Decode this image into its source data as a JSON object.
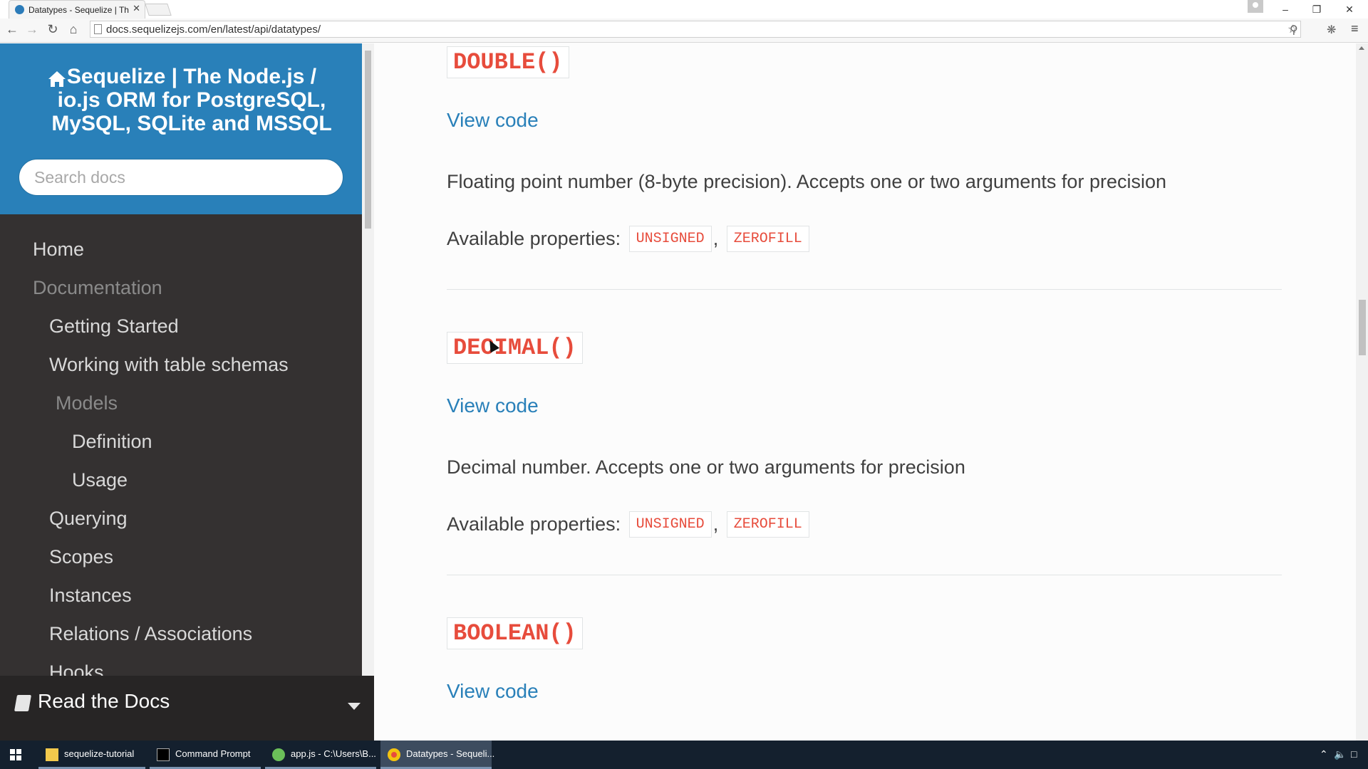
{
  "browser": {
    "tab_title": "Datatypes - Sequelize | Th",
    "tab_close": "✕",
    "url": "docs.sequelizejs.com/en/latest/api/datatypes/"
  },
  "sidebar": {
    "project_title": "Sequelize | The Node.js / io.js ORM for PostgreSQL, MySQL, SQLite and MSSQL",
    "search_placeholder": "Search docs",
    "nav": {
      "home": "Home",
      "documentation": "Documentation",
      "getting_started": "Getting Started",
      "working_with_schemas": "Working with table schemas",
      "models": "Models",
      "definition": "Definition",
      "usage": "Usage",
      "querying": "Querying",
      "scopes": "Scopes",
      "instances": "Instances",
      "relations": "Relations / Associations",
      "hooks": "Hooks"
    },
    "read_the_docs": "Read the Docs"
  },
  "content": {
    "sections": [
      {
        "title": "DOUBLE()",
        "view_code": "View code",
        "description": "Floating point number (8-byte precision). Accepts one or two arguments for precision",
        "props_label": "Available properties:",
        "props": [
          "UNSIGNED",
          "ZEROFILL"
        ]
      },
      {
        "title": "DECIMAL()",
        "view_code": "View code",
        "description": "Decimal number. Accepts one or two arguments for precision",
        "props_label": "Available properties:",
        "props": [
          "UNSIGNED",
          "ZEROFILL"
        ]
      },
      {
        "title": "BOOLEAN()",
        "view_code": "View code"
      }
    ],
    "comma": ","
  },
  "taskbar": {
    "items": [
      "sequelize-tutorial",
      "Command Prompt",
      "app.js - C:\\Users\\B...",
      "Datatypes - Sequeli..."
    ]
  },
  "colors": {
    "sidebar_header": "#2980b9",
    "sidebar_bg": "#343131",
    "link": "#2980b9",
    "code_red": "#e74c3c"
  }
}
